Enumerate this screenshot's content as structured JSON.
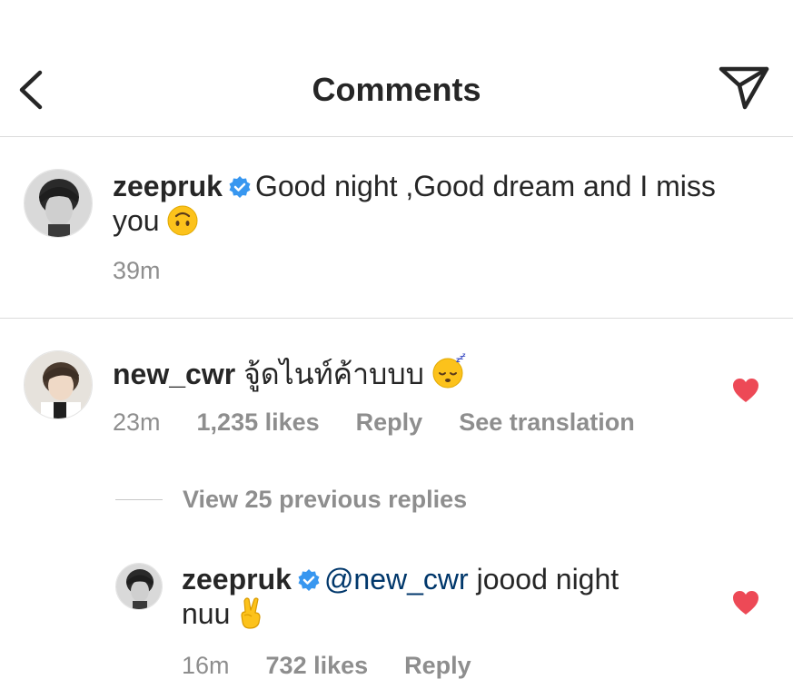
{
  "header": {
    "title": "Comments"
  },
  "caption": {
    "username": "zeepruk",
    "text": "Good night ,Good dream and I miss",
    "text_line2": "you",
    "time": "39m"
  },
  "comment": {
    "username": "new_cwr",
    "text": "จู้ดไนท์ค้าบบบ",
    "time": "23m",
    "likes": "1,235 likes",
    "reply_label": "Reply",
    "translate_label": "See translation"
  },
  "view_replies": {
    "label": "View 25 previous replies"
  },
  "reply": {
    "username": "zeepruk",
    "mention": "@new_cwr",
    "text": "joood night",
    "text_line2": "nuu",
    "time": "16m",
    "likes": "732 likes",
    "reply_label": "Reply"
  },
  "colors": {
    "heart": "#ed4956",
    "verified": "#3897f0",
    "mention": "#00376b",
    "secondary_text": "#8e8e8e"
  },
  "icons": {
    "back": "chevron-left-icon",
    "send": "paper-plane-icon",
    "verified": "verified-badge-icon",
    "heart": "heart-icon"
  }
}
